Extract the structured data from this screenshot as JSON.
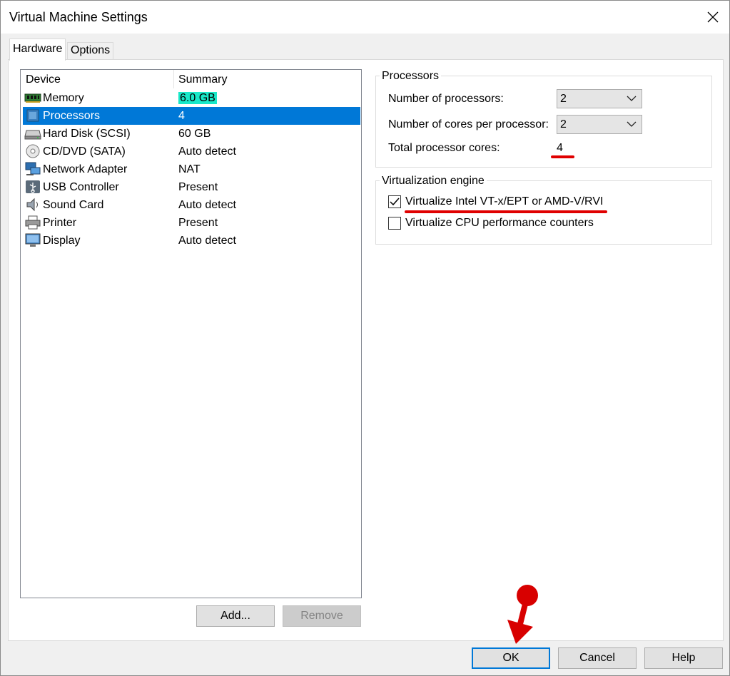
{
  "window": {
    "title": "Virtual Machine Settings"
  },
  "tabs": [
    {
      "label": "Hardware",
      "active": true
    },
    {
      "label": "Options",
      "active": false
    }
  ],
  "device_list": {
    "columns": [
      "Device",
      "Summary"
    ],
    "rows": [
      {
        "icon": "memory-icon",
        "device": "Memory",
        "summary": "6.0 GB",
        "highlighted": true
      },
      {
        "icon": "processor-icon",
        "device": "Processors",
        "summary": "4",
        "selected": true
      },
      {
        "icon": "hard-disk-icon",
        "device": "Hard Disk (SCSI)",
        "summary": "60 GB"
      },
      {
        "icon": "cd-dvd-icon",
        "device": "CD/DVD (SATA)",
        "summary": "Auto detect"
      },
      {
        "icon": "network-adapter-icon",
        "device": "Network Adapter",
        "summary": "NAT"
      },
      {
        "icon": "usb-icon",
        "device": "USB Controller",
        "summary": "Present"
      },
      {
        "icon": "sound-card-icon",
        "device": "Sound Card",
        "summary": "Auto detect"
      },
      {
        "icon": "printer-icon",
        "device": "Printer",
        "summary": "Present"
      },
      {
        "icon": "display-icon",
        "device": "Display",
        "summary": "Auto detect"
      }
    ]
  },
  "list_buttons": {
    "add": "Add...",
    "remove": "Remove"
  },
  "processors": {
    "group_label": "Processors",
    "num_processors_label": "Number of processors:",
    "num_processors_value": "2",
    "cores_per_processor_label": "Number of cores per processor:",
    "cores_per_processor_value": "2",
    "total_cores_label": "Total processor cores:",
    "total_cores_value": "4"
  },
  "virtualization": {
    "group_label": "Virtualization engine",
    "vtx_label": "Virtualize Intel VT-x/EPT or AMD-V/RVI",
    "vtx_checked": true,
    "perf_counters_label": "Virtualize CPU performance counters",
    "perf_counters_checked": false
  },
  "footer_buttons": {
    "ok": "OK",
    "cancel": "Cancel",
    "help": "Help"
  },
  "colors": {
    "selection": "#0078d7",
    "highlight": "#19e8c8",
    "annotation": "#e00000"
  }
}
